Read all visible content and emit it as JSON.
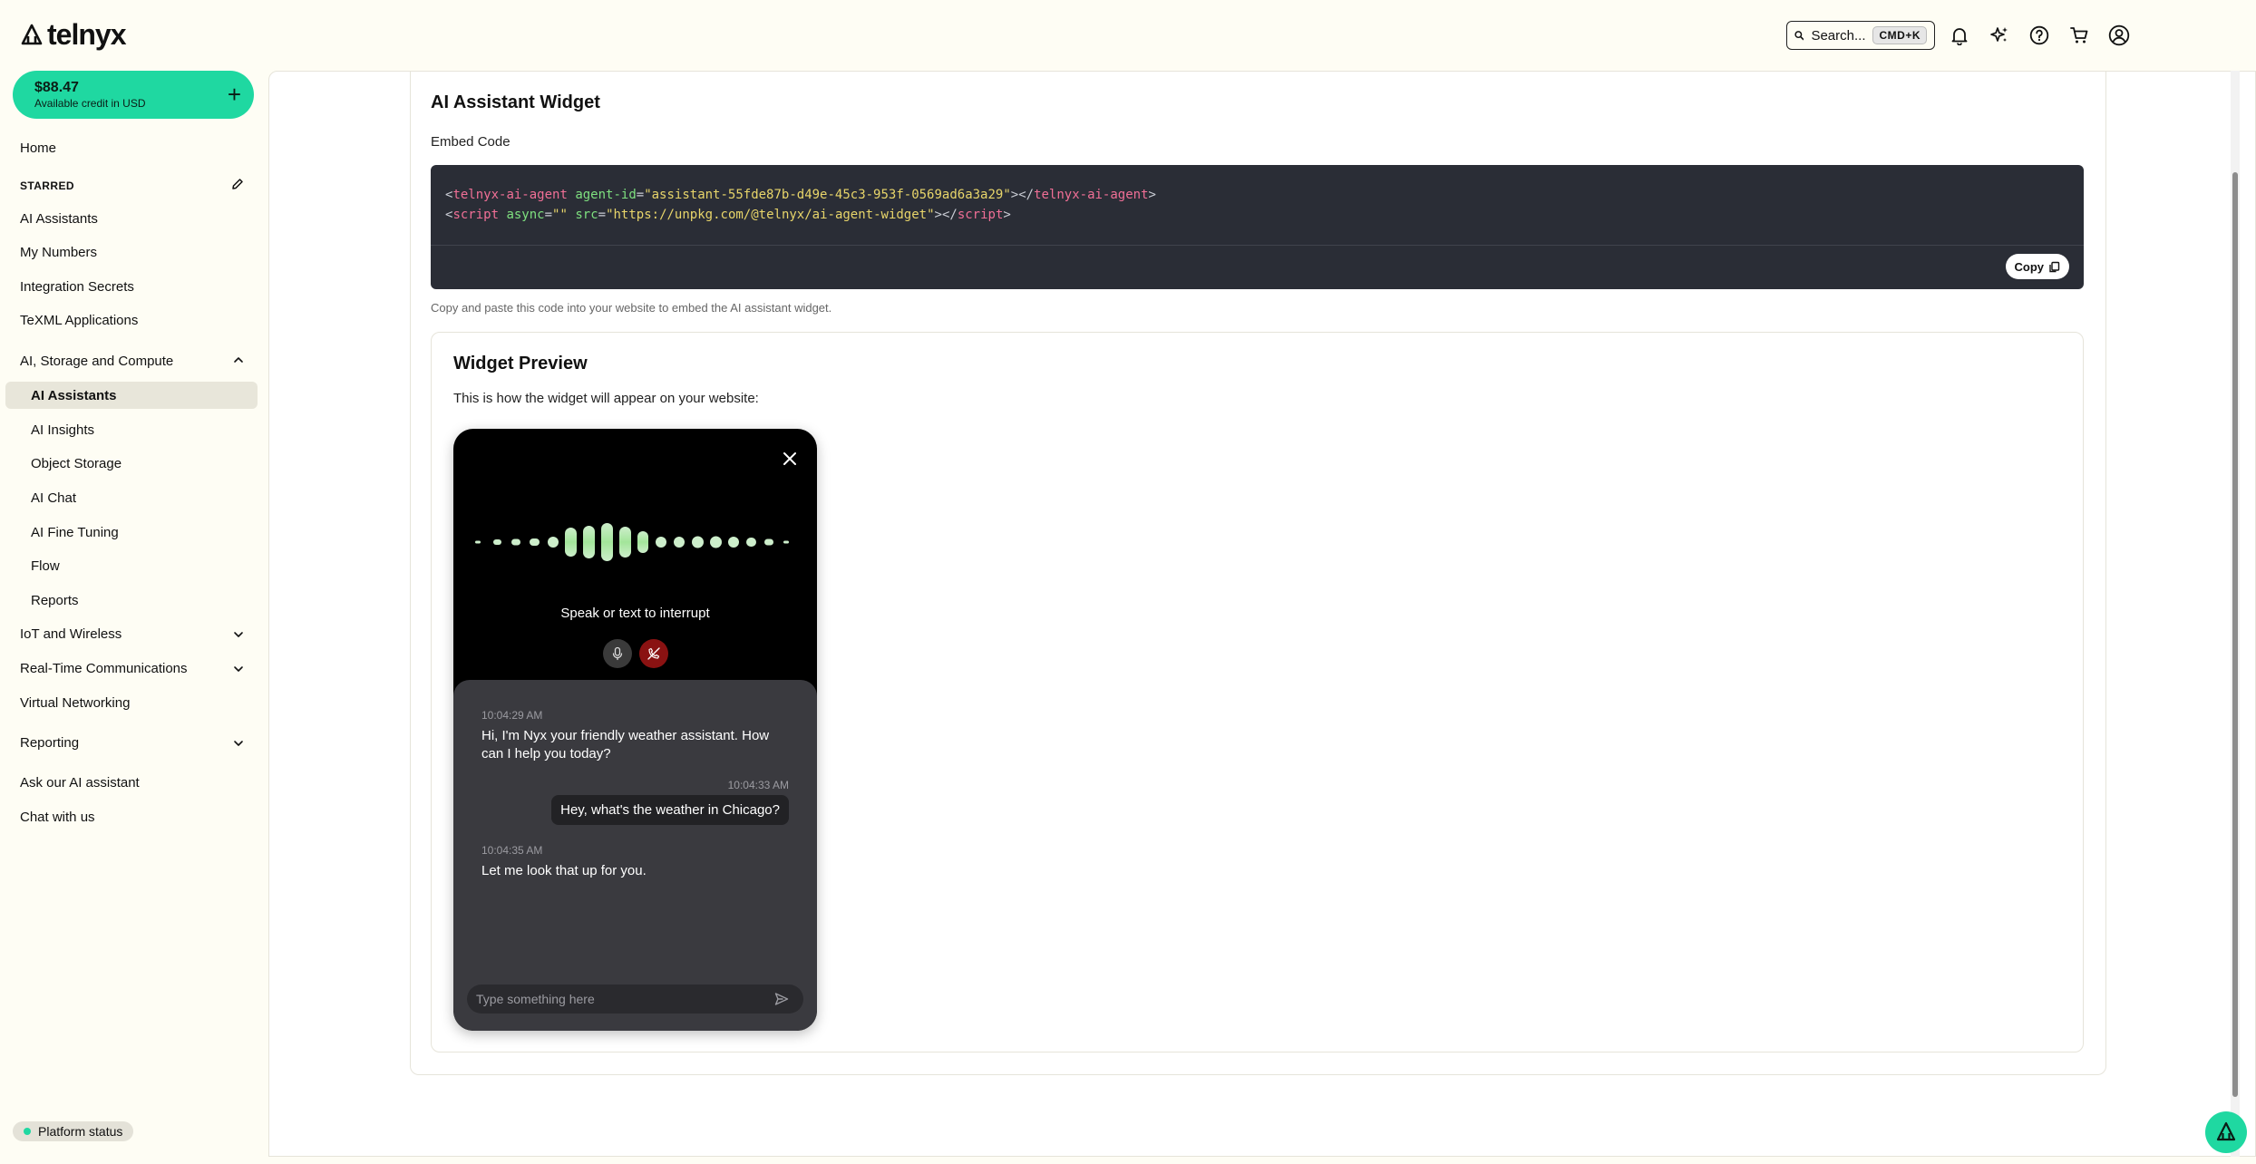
{
  "header": {
    "logo_text": "telnyx",
    "search_label": "Search...",
    "search_shortcut": "CMD+K"
  },
  "sidebar": {
    "credit_amount": "$88.47",
    "credit_label": "Available credit in USD",
    "home": "Home",
    "starred_heading": "STARRED",
    "starred": [
      "AI Assistants",
      "My Numbers",
      "Integration Secrets",
      "TeXML Applications"
    ],
    "section_ai": "AI, Storage and Compute",
    "ai_items": [
      "AI Assistants",
      "AI Insights",
      "Object Storage",
      "AI Chat",
      "AI Fine Tuning",
      "Flow",
      "Reports"
    ],
    "section_iot": "IoT and Wireless",
    "section_rtc": "Real-Time Communications",
    "virtual_networking": "Virtual Networking",
    "section_reporting": "Reporting",
    "ask_ai": "Ask our AI assistant",
    "chat_with_us": "Chat with us",
    "platform_status": "Platform status"
  },
  "main": {
    "title": "AI Assistant Widget",
    "embed_label": "Embed Code",
    "code": {
      "line1": {
        "open_tag": "telnyx-ai-agent",
        "attr": "agent-id",
        "value": "\"assistant-55fde87b-d49e-45c3-953f-0569ad6a3a29\"",
        "close_tag": "telnyx-ai-agent"
      },
      "line2": {
        "open_tag": "script",
        "attr1": "async",
        "value1": "\"\"",
        "attr2": "src",
        "value2": "\"https://unpkg.com/@telnyx/ai-agent-widget\"",
        "close_tag": "script"
      }
    },
    "copy_label": "Copy",
    "helper_text": "Copy and paste this code into your website to embed the AI assistant widget.",
    "preview_title": "Widget Preview",
    "preview_desc": "This is how the widget will appear on your website:"
  },
  "widget": {
    "prompt": "Speak or text to interrupt",
    "messages": [
      {
        "role": "assistant",
        "time": "10:04:29 AM",
        "text": "Hi, I'm Nyx your friendly weather assistant. How can I help you today?"
      },
      {
        "role": "user",
        "time": "10:04:33 AM",
        "text": "Hey, what's the weather in Chicago?"
      },
      {
        "role": "assistant",
        "time": "10:04:35 AM",
        "text": "Let me look that up for you."
      }
    ],
    "input_placeholder": "Type something here",
    "accent_color": "#a3e59a"
  },
  "colors": {
    "brand_green": "#1fd8a1",
    "code_bg": "#2a2d36",
    "hangup_red": "#8a1212"
  }
}
